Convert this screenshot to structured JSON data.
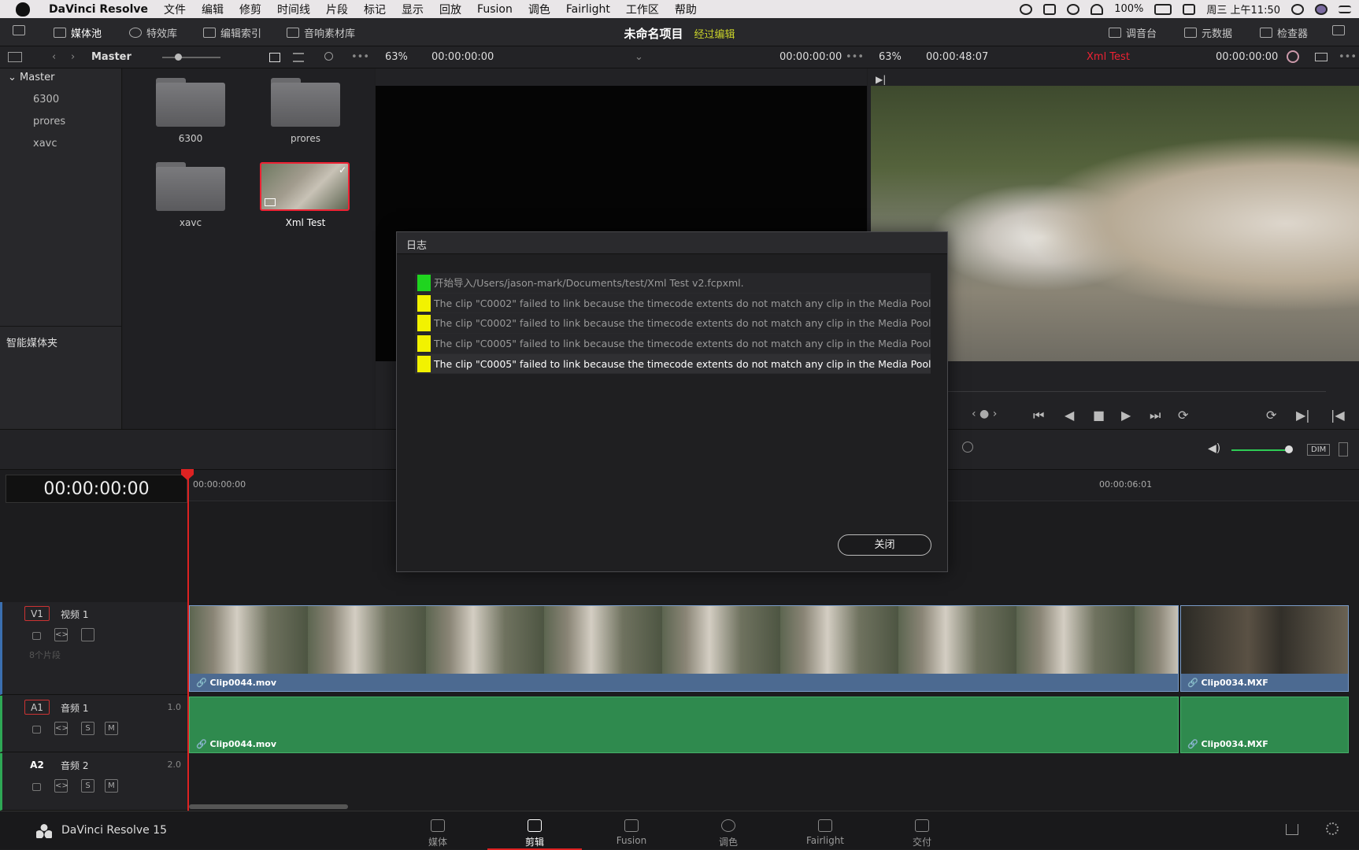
{
  "menubar": {
    "app": "DaVinci Resolve",
    "items": [
      "文件",
      "编辑",
      "修剪",
      "时间线",
      "片段",
      "标记",
      "显示",
      "回放",
      "Fusion",
      "调色",
      "Fairlight",
      "工作区",
      "帮助"
    ],
    "battery": "100%",
    "clock": "周三 上午11:50"
  },
  "toolbar": {
    "media_pool": "媒体池",
    "effects": "特效库",
    "edit_index": "编辑索引",
    "sound_library": "音响素材库",
    "project_title": "未命名项目",
    "project_status": "经过编辑",
    "mixer": "调音台",
    "metadata": "元数据",
    "inspector": "检查器"
  },
  "header": {
    "bin": "Master",
    "src_zoom": "63%",
    "src_tc": "00:00:00:00",
    "src_tc2": "00:00:00:00",
    "tl_zoom": "63%",
    "tl_duration": "00:00:48:07",
    "tl_name": "Xml Test",
    "tl_tc": "00:00:00:00"
  },
  "bins": {
    "root": "Master",
    "children": [
      "6300",
      "prores",
      "xavc"
    ],
    "smart_bins": "智能媒体夹"
  },
  "pool_items": [
    "6300",
    "prores",
    "xavc",
    "Xml Test"
  ],
  "timeline": {
    "timecode": "00:00:00:00",
    "ruler_start": "00:00:00:00",
    "ruler_mark": "00:00:06:01",
    "tracks": [
      {
        "badge": "V1",
        "name": "视频 1",
        "info": "8个片段"
      },
      {
        "badge": "A1",
        "name": "音频 1",
        "level": "1.0",
        "s": "S",
        "m": "M"
      },
      {
        "badge": "A2",
        "name": "音频 2",
        "level": "2.0",
        "s": "S",
        "m": "M"
      }
    ],
    "clips": {
      "v1_a": "Clip0044.mov",
      "v1_b": "Clip0034.MXF",
      "a1_a": "Clip0044.mov",
      "a1_b": "Clip0034.MXF"
    },
    "dim": "DIM"
  },
  "dialog": {
    "title": "日志",
    "rows": [
      {
        "color": "#1fd41f",
        "text": "开始导入/Users/jason-mark/Documents/test/Xml Test v2.fcpxml."
      },
      {
        "color": "#f2f200",
        "text": "The clip \"C0002\" failed to link because the timecode extents do not match any clip in the Media Pool."
      },
      {
        "color": "#f2f200",
        "text": "The clip \"C0002\" failed to link because the timecode extents do not match any clip in the Media Pool."
      },
      {
        "color": "#f2f200",
        "text": "The clip \"C0005\" failed to link because the timecode extents do not match any clip in the Media Pool."
      },
      {
        "color": "#f2f200",
        "text": "The clip \"C0005\" failed to link because the timecode extents do not match any clip in the Media Pool."
      }
    ],
    "close": "关闭"
  },
  "pages": {
    "brand": "DaVinci Resolve 15",
    "tabs": [
      "媒体",
      "剪辑",
      "Fusion",
      "调色",
      "Fairlight",
      "交付"
    ],
    "active": "剪辑"
  }
}
